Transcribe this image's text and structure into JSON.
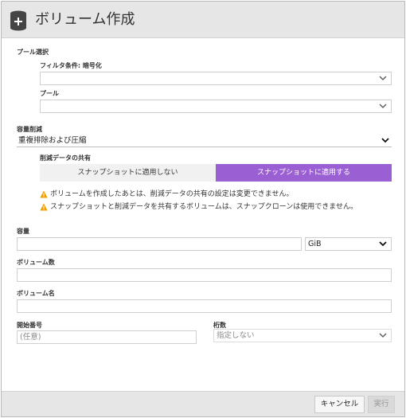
{
  "header": {
    "title": "ボリューム作成",
    "icon": "database-add-icon"
  },
  "pool_section": {
    "label": "プール選択",
    "filter_label": "フィルタ条件: 暗号化",
    "filter_value": "",
    "pool_label": "プール",
    "pool_value": ""
  },
  "reduction": {
    "label": "容量削減",
    "value": "重複排除および圧縮",
    "share_label": "削減データの共有",
    "toggle_off": "スナップショットに適用しない",
    "toggle_on": "スナップショットに適用する",
    "selected": "toggle_on",
    "warning1": "ボリュームを作成したあとは、削減データの共有の設定は変更できません。",
    "warning2": "スナップショットと削減データを共有するボリュームは、スナップクローンは使用できません。"
  },
  "capacity": {
    "label": "容量",
    "value": "",
    "unit": "GiB"
  },
  "volume_count": {
    "label": "ボリューム数",
    "value": ""
  },
  "volume_name": {
    "label": "ボリューム名",
    "value": ""
  },
  "start_number": {
    "label": "開始番号",
    "placeholder": "(任意)"
  },
  "digits": {
    "label": "桁数",
    "value": "指定しない"
  },
  "footer": {
    "cancel": "キャンセル",
    "run": "実行"
  },
  "colors": {
    "accent": "#9b5fd4",
    "warning": "#f0a000",
    "header_bg": "#e6e6e6"
  }
}
